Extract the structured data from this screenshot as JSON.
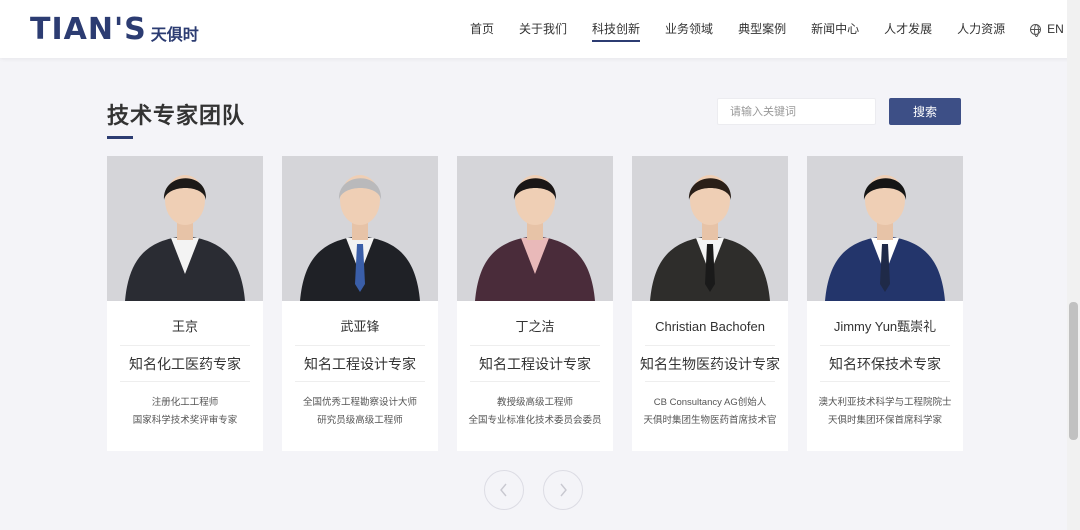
{
  "brand": {
    "logo_text": "TIAN'S",
    "logo_cn": "天俱时",
    "color": "#2c3c72"
  },
  "nav": {
    "items": [
      {
        "label": "首页"
      },
      {
        "label": "关于我们"
      },
      {
        "label": "科技创新",
        "active": true
      },
      {
        "label": "业务领域"
      },
      {
        "label": "典型案例"
      },
      {
        "label": "新闻中心"
      },
      {
        "label": "人才发展"
      },
      {
        "label": "人力资源"
      }
    ],
    "lang": "EN"
  },
  "section": {
    "title": "技术专家团队"
  },
  "search": {
    "placeholder": "请输入关键词",
    "button_label": "搜索",
    "button_color": "#3d4f86"
  },
  "experts": [
    {
      "name": "王京",
      "title": "知名化工医药专家",
      "desc": [
        "注册化工工程师",
        "国家科学技术奖评审专家"
      ],
      "suit": "#2a2c33",
      "shirt": "#f3f3f3",
      "hair": "#1d1a18",
      "tie": ""
    },
    {
      "name": "武亚锋",
      "title": "知名工程设计专家",
      "desc": [
        "全国优秀工程勘察设计大师",
        "研究员级高级工程师"
      ],
      "suit": "#1f2126",
      "shirt": "#f2f2f2",
      "hair": "#b9b9bb",
      "tie": "#3a5ea8"
    },
    {
      "name": "丁之洁",
      "title": "知名工程设计专家",
      "desc": [
        "教授级高级工程师",
        "全国专业标准化技术委员会委员"
      ],
      "suit": "#4a2c3a",
      "shirt": "#e9b9b9",
      "hair": "#1a1616",
      "tie": ""
    },
    {
      "name": "Christian Bachofen",
      "title": "知名生物医药设计专家",
      "desc": [
        "CB Consultancy AG创始人",
        "天俱时集团生物医药首席技术官"
      ],
      "suit": "#2e2d2b",
      "shirt": "#f4f4f4",
      "hair": "#2a1f18",
      "tie": "#1a1a1a"
    },
    {
      "name": "Jimmy Yun甄崇礼",
      "title": "知名环保技术专家",
      "desc": [
        "澳大利亚技术科学与工程院院士",
        "天俱时集团环保首席科学家"
      ],
      "suit": "#23356b",
      "shirt": "#ffffff",
      "hair": "#151515",
      "tie": "#1f2a48"
    }
  ],
  "pager": {
    "prev_icon": "chevron-left-icon",
    "next_icon": "chevron-right-icon"
  }
}
